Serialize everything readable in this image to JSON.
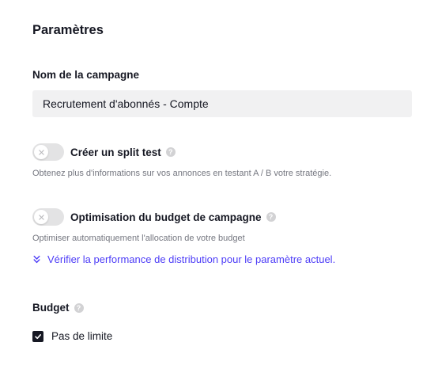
{
  "settings": {
    "title": "Paramètres",
    "campaign_name": {
      "label": "Nom de la campagne",
      "value": "Recrutement d'abonnés - Compte"
    },
    "split_test": {
      "label": "Créer un split test",
      "enabled": false,
      "hint": "Obtenez plus d'informations sur vos annonces en testant A / B votre stratégie."
    },
    "budget_optimization": {
      "label": "Optimisation du budget de campagne",
      "enabled": false,
      "hint": "Optimiser automatiquement l'allocation de votre budget",
      "link": "Vérifier la performance de distribution pour le paramètre actuel."
    },
    "budget": {
      "label": "Budget",
      "no_limit_label": "Pas de limite",
      "no_limit_checked": true
    },
    "help_glyph": "?",
    "colors": {
      "link": "#4d3df7",
      "toggle_off": "#e3e3e4",
      "input_bg": "#f1f1f2",
      "checkbox": "#161823"
    }
  }
}
